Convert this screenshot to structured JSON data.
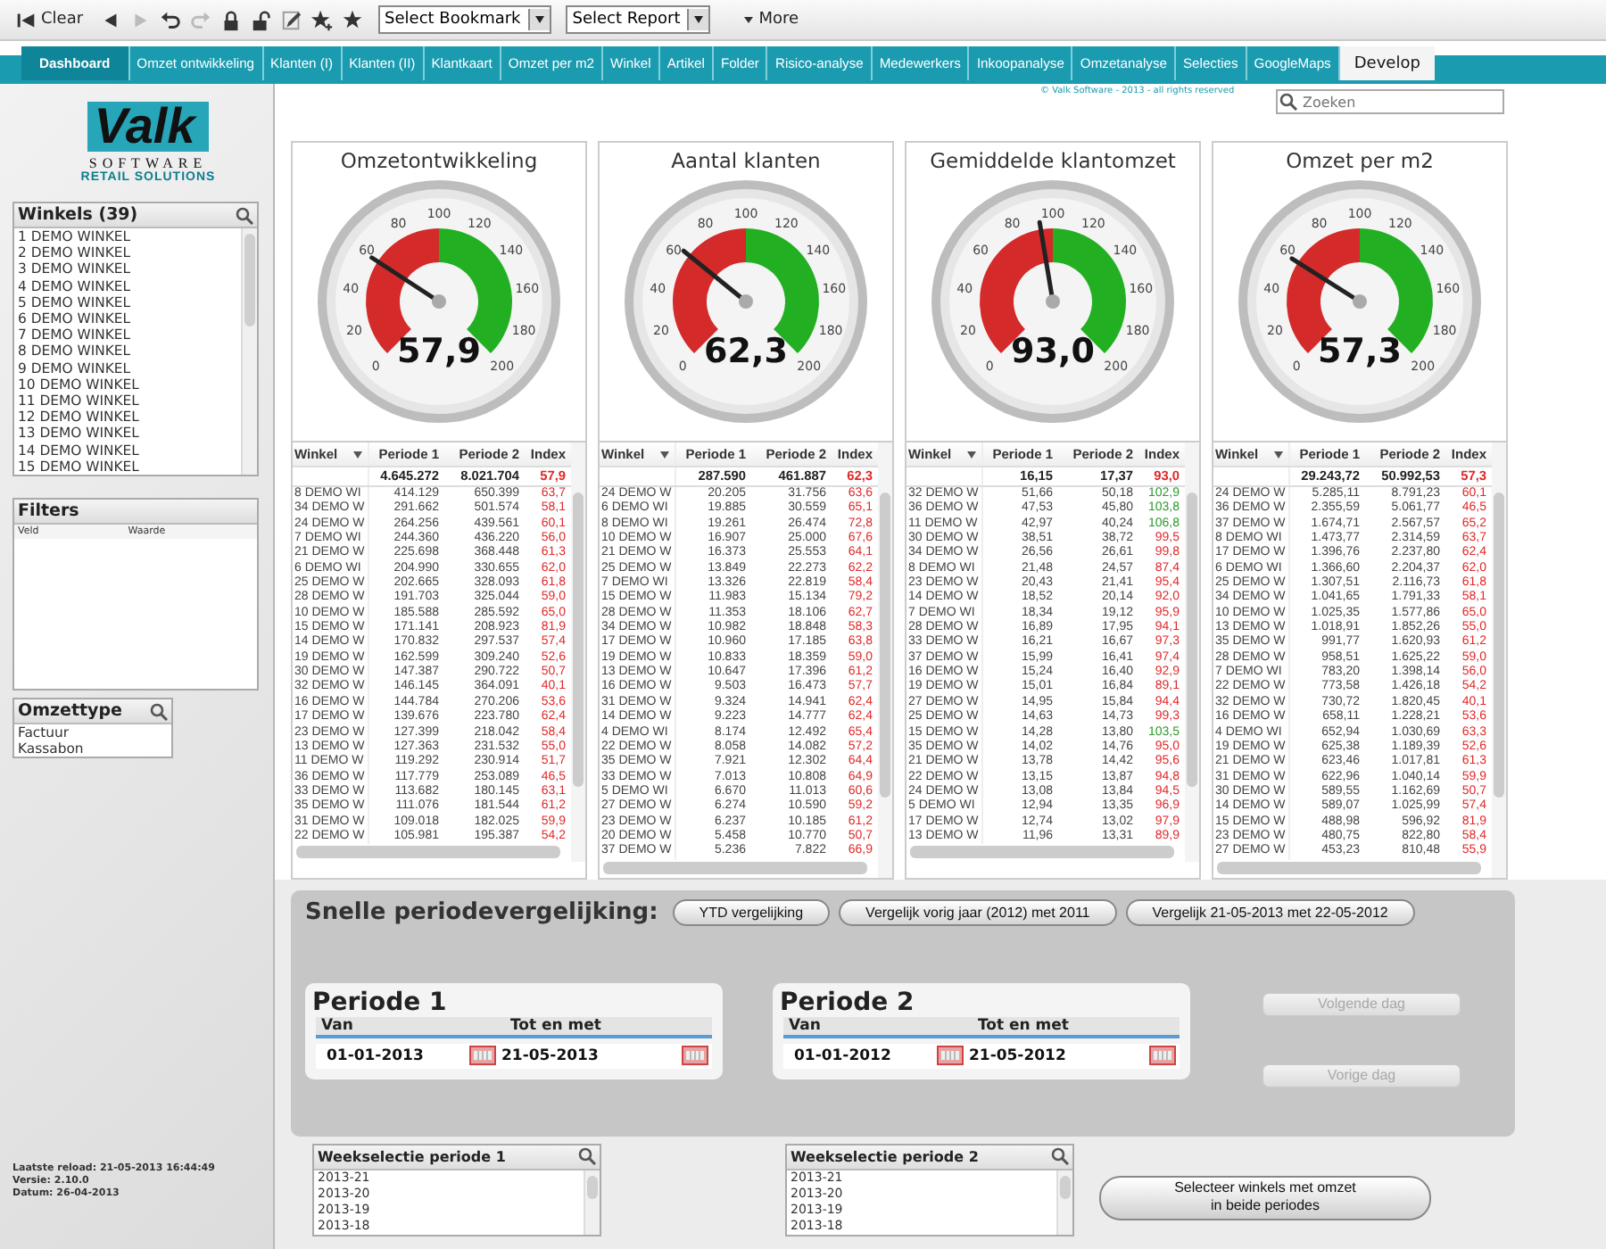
{
  "toolbar": {
    "clear": "Clear",
    "bookmark": "Select Bookmark",
    "report": "Select Report",
    "more": "More"
  },
  "tabs": [
    {
      "label": "Dashboard",
      "selected": true
    },
    {
      "label": "Omzet ontwikkeling",
      "selected": false
    },
    {
      "label": "Klanten (I)",
      "selected": false
    },
    {
      "label": "Klanten (II)",
      "selected": false
    },
    {
      "label": "Klantkaart",
      "selected": false
    },
    {
      "label": "Omzet per m2",
      "selected": false
    },
    {
      "label": "Winkel",
      "selected": false
    },
    {
      "label": "Artikel",
      "selected": false
    },
    {
      "label": "Folder",
      "selected": false
    },
    {
      "label": "Risico-analyse",
      "selected": false
    },
    {
      "label": "Medewerkers",
      "selected": false
    },
    {
      "label": "Inkoopanalyse",
      "selected": false
    },
    {
      "label": "Omzetanalyse",
      "selected": false
    },
    {
      "label": "Selecties",
      "selected": false
    },
    {
      "label": "GoogleMaps",
      "selected": false
    }
  ],
  "develop_tab": "Develop",
  "sidebar": {
    "logo": {
      "name": "Valk",
      "line_1": "SOFTWARE",
      "line_2": "RETAIL SOLUTIONS"
    },
    "winkels": {
      "title": "Winkels (39)",
      "items": [
        "1 DEMO WINKEL",
        "2 DEMO WINKEL",
        "3 DEMO WINKEL",
        "4 DEMO WINKEL",
        "5 DEMO WINKEL",
        "6 DEMO WINKEL",
        "7 DEMO WINKEL",
        "8 DEMO WINKEL",
        "9 DEMO WINKEL",
        "10 DEMO WINKEL",
        "11 DEMO WINKEL",
        "12 DEMO WINKEL",
        "13 DEMO WINKEL",
        "14 DEMO WINKEL",
        "15 DEMO WINKEL"
      ]
    },
    "filters": {
      "title": "Filters",
      "columns": [
        "Veld",
        "Waarde"
      ]
    },
    "omzettype": {
      "title": "Omzettype",
      "items": [
        "Factuur",
        "Kassabon"
      ]
    },
    "footer": [
      "Laatste reload: 21-05-2013 16:44:49",
      "Versie: 2.10.0",
      "Datum: 26-04-2013"
    ]
  },
  "copyright": "© Valk Software - 2013 - all rights reserved",
  "search": {
    "placeholder": "Zoeken"
  },
  "panels": [
    {
      "title": "Omzetontwikkeling",
      "value": "57,9",
      "scale": [
        "0",
        "20",
        "40",
        "60",
        "80",
        "100",
        "120",
        "140",
        "160",
        "180",
        "200"
      ],
      "table": {
        "columns": [
          "Winkel",
          "Periode 1",
          "Periode 2",
          "Index"
        ],
        "total": {
          "periode_1": "4.645.272",
          "periode_2": "8.021.704",
          "index": "57,9",
          "color": "#e02828"
        },
        "rows": [
          {
            "winkel": "8 DEMO WI",
            "periode_1": "414.129",
            "periode_2": "650.399",
            "index": "63,7",
            "color": "#e02828"
          },
          {
            "winkel": "34 DEMO W",
            "periode_1": "291.662",
            "periode_2": "501.574",
            "index": "58,1",
            "color": "#e02828"
          },
          {
            "winkel": "24 DEMO W",
            "periode_1": "264.256",
            "periode_2": "439.561",
            "index": "60,1",
            "color": "#e02828"
          },
          {
            "winkel": "7 DEMO WI",
            "periode_1": "244.360",
            "periode_2": "436.220",
            "index": "56,0",
            "color": "#e02828"
          },
          {
            "winkel": "21 DEMO W",
            "periode_1": "225.698",
            "periode_2": "368.448",
            "index": "61,3",
            "color": "#e02828"
          },
          {
            "winkel": "6 DEMO WI",
            "periode_1": "204.990",
            "periode_2": "330.655",
            "index": "62,0",
            "color": "#e02828"
          },
          {
            "winkel": "25 DEMO W",
            "periode_1": "202.665",
            "periode_2": "328.093",
            "index": "61,8",
            "color": "#e02828"
          },
          {
            "winkel": "28 DEMO W",
            "periode_1": "191.703",
            "periode_2": "325.044",
            "index": "59,0",
            "color": "#e02828"
          },
          {
            "winkel": "10 DEMO W",
            "periode_1": "185.588",
            "periode_2": "285.592",
            "index": "65,0",
            "color": "#e02828"
          },
          {
            "winkel": "15 DEMO W",
            "periode_1": "171.141",
            "periode_2": "208.923",
            "index": "81,9",
            "color": "#e02828"
          },
          {
            "winkel": "14 DEMO W",
            "periode_1": "170.832",
            "periode_2": "297.537",
            "index": "57,4",
            "color": "#e02828"
          },
          {
            "winkel": "19 DEMO W",
            "periode_1": "162.599",
            "periode_2": "309.240",
            "index": "52,6",
            "color": "#e02828"
          },
          {
            "winkel": "30 DEMO W",
            "periode_1": "147.387",
            "periode_2": "290.722",
            "index": "50,7",
            "color": "#e02828"
          },
          {
            "winkel": "32 DEMO W",
            "periode_1": "146.145",
            "periode_2": "364.091",
            "index": "40,1",
            "color": "#e02828"
          },
          {
            "winkel": "16 DEMO W",
            "periode_1": "144.784",
            "periode_2": "270.206",
            "index": "53,6",
            "color": "#e02828"
          },
          {
            "winkel": "17 DEMO W",
            "periode_1": "139.676",
            "periode_2": "223.780",
            "index": "62,4",
            "color": "#e02828"
          },
          {
            "winkel": "23 DEMO W",
            "periode_1": "127.399",
            "periode_2": "218.042",
            "index": "58,4",
            "color": "#e02828"
          },
          {
            "winkel": "13 DEMO W",
            "periode_1": "127.363",
            "periode_2": "231.532",
            "index": "55,0",
            "color": "#e02828"
          },
          {
            "winkel": "11 DEMO W",
            "periode_1": "119.292",
            "periode_2": "230.914",
            "index": "51,7",
            "color": "#e02828"
          },
          {
            "winkel": "36 DEMO W",
            "periode_1": "117.779",
            "periode_2": "253.089",
            "index": "46,5",
            "color": "#e02828"
          },
          {
            "winkel": "33 DEMO W",
            "periode_1": "113.682",
            "periode_2": "180.145",
            "index": "63,1",
            "color": "#e02828"
          },
          {
            "winkel": "35 DEMO W",
            "periode_1": "111.076",
            "periode_2": "181.544",
            "index": "61,2",
            "color": "#e02828"
          },
          {
            "winkel": "31 DEMO W",
            "periode_1": "109.018",
            "periode_2": "182.025",
            "index": "59,9",
            "color": "#e02828"
          },
          {
            "winkel": "22 DEMO W",
            "periode_1": "105.981",
            "periode_2": "195.387",
            "index": "54,2",
            "color": "#e02828"
          }
        ]
      }
    },
    {
      "title": "Aantal klanten",
      "value": "62,3",
      "scale": [
        "0",
        "20",
        "40",
        "60",
        "80",
        "100",
        "120",
        "140",
        "160",
        "180",
        "200"
      ],
      "table": {
        "columns": [
          "Winkel",
          "Periode 1",
          "Periode 2",
          "Index"
        ],
        "total": {
          "periode_1": "287.590",
          "periode_2": "461.887",
          "index": "62,3",
          "color": "#e02828"
        },
        "rows": [
          {
            "winkel": "24 DEMO W",
            "periode_1": "20.205",
            "periode_2": "31.756",
            "index": "63,6",
            "color": "#e02828"
          },
          {
            "winkel": "6 DEMO WI",
            "periode_1": "19.885",
            "periode_2": "30.559",
            "index": "65,1",
            "color": "#e02828"
          },
          {
            "winkel": "8 DEMO WI",
            "periode_1": "19.261",
            "periode_2": "26.474",
            "index": "72,8",
            "color": "#e02828"
          },
          {
            "winkel": "10 DEMO W",
            "periode_1": "16.907",
            "periode_2": "25.000",
            "index": "67,6",
            "color": "#e02828"
          },
          {
            "winkel": "21 DEMO W",
            "periode_1": "16.373",
            "periode_2": "25.553",
            "index": "64,1",
            "color": "#e02828"
          },
          {
            "winkel": "25 DEMO W",
            "periode_1": "13.849",
            "periode_2": "22.273",
            "index": "62,2",
            "color": "#e02828"
          },
          {
            "winkel": "7 DEMO WI",
            "periode_1": "13.326",
            "periode_2": "22.819",
            "index": "58,4",
            "color": "#e02828"
          },
          {
            "winkel": "15 DEMO W",
            "periode_1": "11.983",
            "periode_2": "15.134",
            "index": "79,2",
            "color": "#e02828"
          },
          {
            "winkel": "28 DEMO W",
            "periode_1": "11.353",
            "periode_2": "18.106",
            "index": "62,7",
            "color": "#e02828"
          },
          {
            "winkel": "34 DEMO W",
            "periode_1": "10.982",
            "periode_2": "18.848",
            "index": "58,3",
            "color": "#e02828"
          },
          {
            "winkel": "17 DEMO W",
            "periode_1": "10.960",
            "periode_2": "17.185",
            "index": "63,8",
            "color": "#e02828"
          },
          {
            "winkel": "19 DEMO W",
            "periode_1": "10.833",
            "periode_2": "18.359",
            "index": "59,0",
            "color": "#e02828"
          },
          {
            "winkel": "13 DEMO W",
            "periode_1": "10.647",
            "periode_2": "17.396",
            "index": "61,2",
            "color": "#e02828"
          },
          {
            "winkel": "16 DEMO W",
            "periode_1": "9.503",
            "periode_2": "16.473",
            "index": "57,7",
            "color": "#e02828"
          },
          {
            "winkel": "31 DEMO W",
            "periode_1": "9.324",
            "periode_2": "14.941",
            "index": "62,4",
            "color": "#e02828"
          },
          {
            "winkel": "14 DEMO W",
            "periode_1": "9.223",
            "periode_2": "14.777",
            "index": "62,4",
            "color": "#e02828"
          },
          {
            "winkel": "4 DEMO WI",
            "periode_1": "8.174",
            "periode_2": "12.492",
            "index": "65,4",
            "color": "#e02828"
          },
          {
            "winkel": "22 DEMO W",
            "periode_1": "8.058",
            "periode_2": "14.082",
            "index": "57,2",
            "color": "#e02828"
          },
          {
            "winkel": "35 DEMO W",
            "periode_1": "7.921",
            "periode_2": "12.302",
            "index": "64,4",
            "color": "#e02828"
          },
          {
            "winkel": "33 DEMO W",
            "periode_1": "7.013",
            "periode_2": "10.808",
            "index": "64,9",
            "color": "#e02828"
          },
          {
            "winkel": "5 DEMO WI",
            "periode_1": "6.670",
            "periode_2": "11.013",
            "index": "60,6",
            "color": "#e02828"
          },
          {
            "winkel": "27 DEMO W",
            "periode_1": "6.274",
            "periode_2": "10.590",
            "index": "59,2",
            "color": "#e02828"
          },
          {
            "winkel": "23 DEMO W",
            "periode_1": "6.237",
            "periode_2": "10.185",
            "index": "61,2",
            "color": "#e02828"
          },
          {
            "winkel": "20 DEMO W",
            "periode_1": "5.458",
            "periode_2": "10.770",
            "index": "50,7",
            "color": "#e02828"
          },
          {
            "winkel": "37 DEMO W",
            "periode_1": "5.236",
            "periode_2": "7.822",
            "index": "66,9",
            "color": "#e02828"
          }
        ]
      }
    },
    {
      "title": "Gemiddelde klantomzet",
      "value": "93,0",
      "scale": [
        "0",
        "20",
        "40",
        "60",
        "80",
        "100",
        "120",
        "140",
        "160",
        "180",
        "200"
      ],
      "table": {
        "columns": [
          "Winkel",
          "Periode 1",
          "Periode 2",
          "Index"
        ],
        "total": {
          "periode_1": "16,15",
          "periode_2": "17,37",
          "index": "93,0",
          "color": "#e02828"
        },
        "rows": [
          {
            "winkel": "32 DEMO W",
            "periode_1": "51,66",
            "periode_2": "50,18",
            "index": "102,9",
            "color": "#2c9a2c"
          },
          {
            "winkel": "36 DEMO W",
            "periode_1": "47,53",
            "periode_2": "45,80",
            "index": "103,8",
            "color": "#2c9a2c"
          },
          {
            "winkel": "11 DEMO W",
            "periode_1": "42,97",
            "periode_2": "40,24",
            "index": "106,8",
            "color": "#2c9a2c"
          },
          {
            "winkel": "30 DEMO W",
            "periode_1": "38,51",
            "periode_2": "38,72",
            "index": "99,5",
            "color": "#e02828"
          },
          {
            "winkel": "34 DEMO W",
            "periode_1": "26,56",
            "periode_2": "26,61",
            "index": "99,8",
            "color": "#e02828"
          },
          {
            "winkel": "8 DEMO WI",
            "periode_1": "21,48",
            "periode_2": "24,57",
            "index": "87,4",
            "color": "#e02828"
          },
          {
            "winkel": "23 DEMO W",
            "periode_1": "20,43",
            "periode_2": "21,41",
            "index": "95,4",
            "color": "#e02828"
          },
          {
            "winkel": "14 DEMO W",
            "periode_1": "18,52",
            "periode_2": "20,14",
            "index": "92,0",
            "color": "#e02828"
          },
          {
            "winkel": "7 DEMO WI",
            "periode_1": "18,34",
            "periode_2": "19,12",
            "index": "95,9",
            "color": "#e02828"
          },
          {
            "winkel": "28 DEMO W",
            "periode_1": "16,89",
            "periode_2": "17,95",
            "index": "94,1",
            "color": "#e02828"
          },
          {
            "winkel": "33 DEMO W",
            "periode_1": "16,21",
            "periode_2": "16,67",
            "index": "97,3",
            "color": "#e02828"
          },
          {
            "winkel": "37 DEMO W",
            "periode_1": "15,99",
            "periode_2": "16,41",
            "index": "97,4",
            "color": "#e02828"
          },
          {
            "winkel": "16 DEMO W",
            "periode_1": "15,24",
            "periode_2": "16,40",
            "index": "92,9",
            "color": "#e02828"
          },
          {
            "winkel": "19 DEMO W",
            "periode_1": "15,01",
            "periode_2": "16,84",
            "index": "89,1",
            "color": "#e02828"
          },
          {
            "winkel": "27 DEMO W",
            "periode_1": "14,95",
            "periode_2": "15,84",
            "index": "94,4",
            "color": "#e02828"
          },
          {
            "winkel": "25 DEMO W",
            "periode_1": "14,63",
            "periode_2": "14,73",
            "index": "99,3",
            "color": "#e02828"
          },
          {
            "winkel": "15 DEMO W",
            "periode_1": "14,28",
            "periode_2": "13,80",
            "index": "103,5",
            "color": "#2c9a2c"
          },
          {
            "winkel": "35 DEMO W",
            "periode_1": "14,02",
            "periode_2": "14,76",
            "index": "95,0",
            "color": "#e02828"
          },
          {
            "winkel": "21 DEMO W",
            "periode_1": "13,78",
            "periode_2": "14,42",
            "index": "95,6",
            "color": "#e02828"
          },
          {
            "winkel": "22 DEMO W",
            "periode_1": "13,15",
            "periode_2": "13,87",
            "index": "94,8",
            "color": "#e02828"
          },
          {
            "winkel": "24 DEMO W",
            "periode_1": "13,08",
            "periode_2": "13,84",
            "index": "94,5",
            "color": "#e02828"
          },
          {
            "winkel": "5 DEMO WI",
            "periode_1": "12,94",
            "periode_2": "13,35",
            "index": "96,9",
            "color": "#e02828"
          },
          {
            "winkel": "17 DEMO W",
            "periode_1": "12,74",
            "periode_2": "13,02",
            "index": "97,9",
            "color": "#e02828"
          },
          {
            "winkel": "13 DEMO W",
            "periode_1": "11,96",
            "periode_2": "13,31",
            "index": "89,9",
            "color": "#e02828"
          }
        ]
      }
    },
    {
      "title": "Omzet per m2",
      "value": "57,3",
      "scale": [
        "0",
        "20",
        "40",
        "60",
        "80",
        "100",
        "120",
        "140",
        "160",
        "180",
        "200"
      ],
      "table": {
        "columns": [
          "Winkel",
          "Periode 1",
          "Periode 2",
          "Index"
        ],
        "total": {
          "periode_1": "29.243,72",
          "periode_2": "50.992,53",
          "index": "57,3",
          "color": "#e02828"
        },
        "rows": [
          {
            "winkel": "24 DEMO W",
            "periode_1": "5.285,11",
            "periode_2": "8.791,23",
            "index": "60,1",
            "color": "#e02828"
          },
          {
            "winkel": "36 DEMO W",
            "periode_1": "2.355,59",
            "periode_2": "5.061,77",
            "index": "46,5",
            "color": "#e02828"
          },
          {
            "winkel": "37 DEMO W",
            "periode_1": "1.674,71",
            "periode_2": "2.567,57",
            "index": "65,2",
            "color": "#e02828"
          },
          {
            "winkel": "8 DEMO WI",
            "periode_1": "1.473,77",
            "periode_2": "2.314,59",
            "index": "63,7",
            "color": "#e02828"
          },
          {
            "winkel": "17 DEMO W",
            "periode_1": "1.396,76",
            "periode_2": "2.237,80",
            "index": "62,4",
            "color": "#e02828"
          },
          {
            "winkel": "6 DEMO WI",
            "periode_1": "1.366,60",
            "periode_2": "2.204,37",
            "index": "62,0",
            "color": "#e02828"
          },
          {
            "winkel": "25 DEMO W",
            "periode_1": "1.307,51",
            "periode_2": "2.116,73",
            "index": "61,8",
            "color": "#e02828"
          },
          {
            "winkel": "34 DEMO W",
            "periode_1": "1.041,65",
            "periode_2": "1.791,33",
            "index": "58,1",
            "color": "#e02828"
          },
          {
            "winkel": "10 DEMO W",
            "periode_1": "1.025,35",
            "periode_2": "1.577,86",
            "index": "65,0",
            "color": "#e02828"
          },
          {
            "winkel": "13 DEMO W",
            "periode_1": "1.018,91",
            "periode_2": "1.852,26",
            "index": "55,0",
            "color": "#e02828"
          },
          {
            "winkel": "35 DEMO W",
            "periode_1": "991,77",
            "periode_2": "1.620,93",
            "index": "61,2",
            "color": "#e02828"
          },
          {
            "winkel": "28 DEMO W",
            "periode_1": "958,51",
            "periode_2": "1.625,22",
            "index": "59,0",
            "color": "#e02828"
          },
          {
            "winkel": "7 DEMO WI",
            "periode_1": "783,20",
            "periode_2": "1.398,14",
            "index": "56,0",
            "color": "#e02828"
          },
          {
            "winkel": "22 DEMO W",
            "periode_1": "773,58",
            "periode_2": "1.426,18",
            "index": "54,2",
            "color": "#e02828"
          },
          {
            "winkel": "32 DEMO W",
            "periode_1": "730,72",
            "periode_2": "1.820,45",
            "index": "40,1",
            "color": "#e02828"
          },
          {
            "winkel": "16 DEMO W",
            "periode_1": "658,11",
            "periode_2": "1.228,21",
            "index": "53,6",
            "color": "#e02828"
          },
          {
            "winkel": "4 DEMO WI",
            "periode_1": "652,94",
            "periode_2": "1.030,69",
            "index": "63,3",
            "color": "#e02828"
          },
          {
            "winkel": "19 DEMO W",
            "periode_1": "625,38",
            "periode_2": "1.189,39",
            "index": "52,6",
            "color": "#e02828"
          },
          {
            "winkel": "21 DEMO W",
            "periode_1": "623,46",
            "periode_2": "1.017,81",
            "index": "61,3",
            "color": "#e02828"
          },
          {
            "winkel": "31 DEMO W",
            "periode_1": "622,96",
            "periode_2": "1.040,14",
            "index": "59,9",
            "color": "#e02828"
          },
          {
            "winkel": "30 DEMO W",
            "periode_1": "589,55",
            "periode_2": "1.162,69",
            "index": "50,7",
            "color": "#e02828"
          },
          {
            "winkel": "14 DEMO W",
            "periode_1": "589,07",
            "periode_2": "1.025,99",
            "index": "57,4",
            "color": "#e02828"
          },
          {
            "winkel": "15 DEMO W",
            "periode_1": "488,98",
            "periode_2": "596,92",
            "index": "81,9",
            "color": "#e02828"
          },
          {
            "winkel": "23 DEMO W",
            "periode_1": "480,75",
            "periode_2": "822,80",
            "index": "58,4",
            "color": "#e02828"
          },
          {
            "winkel": "27 DEMO W",
            "periode_1": "453,23",
            "periode_2": "810,48",
            "index": "55,9",
            "color": "#e02828"
          }
        ]
      }
    }
  ],
  "quick_compare": {
    "title": "Snelle periodevergelijking:",
    "buttons": [
      "YTD vergelijking",
      "Vergelijk vorig jaar (2012) met 2011",
      "Vergelijk 21-05-2013 met 22-05-2012"
    ]
  },
  "periods": [
    {
      "title": "Periode 1",
      "from_label": "Van",
      "to_label": "Tot en met",
      "from": "01-01-2013",
      "to": "21-05-2013"
    },
    {
      "title": "Periode 2",
      "from_label": "Van",
      "to_label": "Tot en met",
      "from": "01-01-2012",
      "to": "21-05-2012"
    }
  ],
  "day_buttons": [
    {
      "label": "Volgende dag",
      "disabled": true
    },
    {
      "label": "Vorige dag",
      "disabled": true
    }
  ],
  "week_lists": [
    {
      "title": "Weekselectie periode 1",
      "items": [
        "2013-21",
        "2013-20",
        "2013-19",
        "2013-18"
      ]
    },
    {
      "title": "Weekselectie periode 2",
      "items": [
        "2013-21",
        "2013-20",
        "2013-19",
        "2013-18"
      ]
    }
  ],
  "select_button": {
    "line_1": "Selecteer winkels met omzet",
    "line_2": "in beide periodes"
  }
}
